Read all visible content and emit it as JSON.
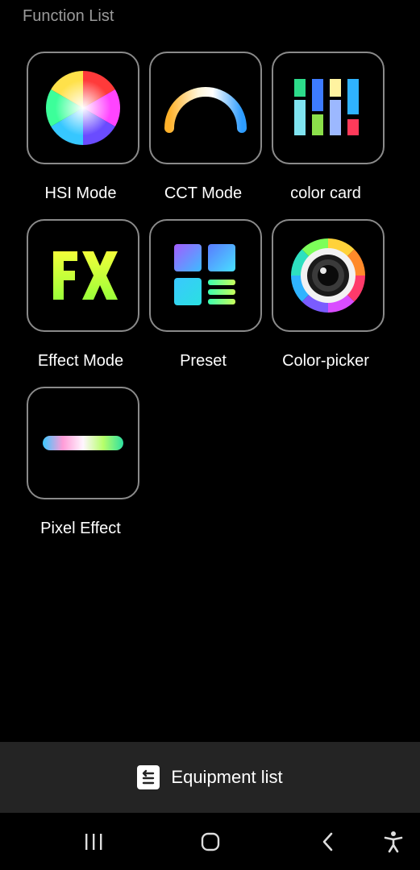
{
  "header": {
    "title": "Function List"
  },
  "functions": [
    {
      "label": "HSI Mode",
      "icon": "color-wheel-icon"
    },
    {
      "label": "CCT Mode",
      "icon": "cct-arc-icon"
    },
    {
      "label": "color card",
      "icon": "color-card-icon"
    },
    {
      "label": "Effect Mode",
      "icon": "fx-icon"
    },
    {
      "label": "Preset",
      "icon": "preset-grid-icon"
    },
    {
      "label": "Color-picker",
      "icon": "color-picker-lens-icon"
    },
    {
      "label": "Pixel Effect",
      "icon": "pixel-bar-icon"
    }
  ],
  "bottom_bar": {
    "label": "Equipment list",
    "icon": "list-return-icon"
  },
  "nav": {
    "recents": "recents-icon",
    "home": "home-icon",
    "back": "back-icon",
    "accessibility": "accessibility-icon"
  }
}
